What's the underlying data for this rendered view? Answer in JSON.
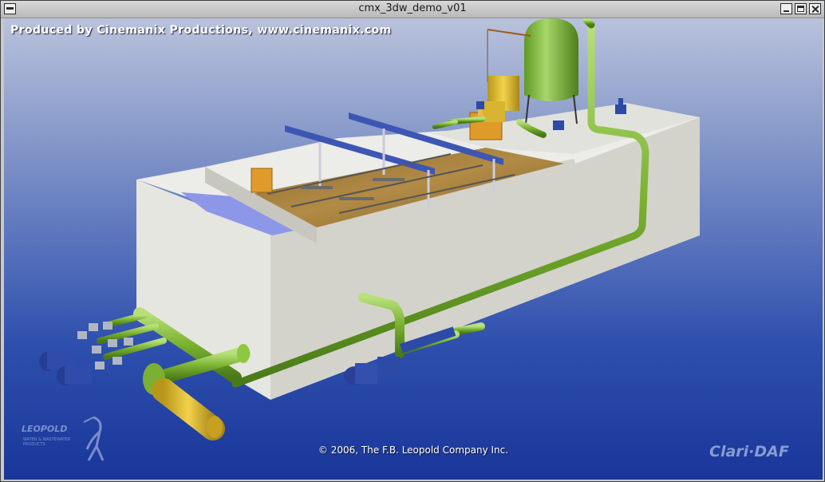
{
  "window": {
    "title": "cmx_3dw_demo_v01",
    "controls": {
      "menu": "window menu",
      "minimize": "minimize",
      "maximize": "maximize",
      "close": "close"
    }
  },
  "overlay": {
    "credit": "Produced by Cinemanix Productions, www.cinemanix.com",
    "copyright": "© 2006, The F.B. Leopold Company Inc.",
    "brand": "Clari·DAF",
    "leopold_wordmark": "LEOPOLD",
    "leopold_tagline": "WATER & WASTEWATER PRODUCTS"
  },
  "scene": {
    "subject": "3D model of dissolved air flotation treatment tank",
    "colors": {
      "concrete": "#d8d8d2",
      "pipe": "#78b02e",
      "blue_equipment": "#2c4aa6",
      "yellow_equipment": "#e9d54a",
      "orange_equipment": "#e09a2a",
      "water": "#8d97e8"
    }
  }
}
